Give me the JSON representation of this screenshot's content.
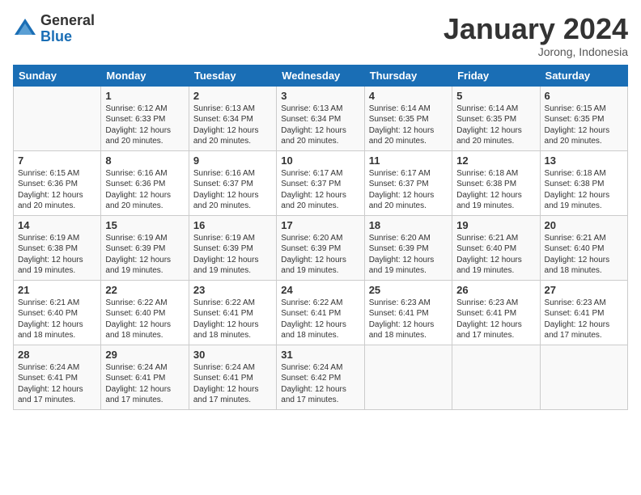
{
  "logo": {
    "general": "General",
    "blue": "Blue"
  },
  "header": {
    "month": "January 2024",
    "location": "Jorong, Indonesia"
  },
  "days_of_week": [
    "Sunday",
    "Monday",
    "Tuesday",
    "Wednesday",
    "Thursday",
    "Friday",
    "Saturday"
  ],
  "weeks": [
    [
      {
        "day": "",
        "sunrise": "",
        "sunset": "",
        "daylight": ""
      },
      {
        "day": "1",
        "sunrise": "Sunrise: 6:12 AM",
        "sunset": "Sunset: 6:33 PM",
        "daylight": "Daylight: 12 hours and 20 minutes."
      },
      {
        "day": "2",
        "sunrise": "Sunrise: 6:13 AM",
        "sunset": "Sunset: 6:34 PM",
        "daylight": "Daylight: 12 hours and 20 minutes."
      },
      {
        "day": "3",
        "sunrise": "Sunrise: 6:13 AM",
        "sunset": "Sunset: 6:34 PM",
        "daylight": "Daylight: 12 hours and 20 minutes."
      },
      {
        "day": "4",
        "sunrise": "Sunrise: 6:14 AM",
        "sunset": "Sunset: 6:35 PM",
        "daylight": "Daylight: 12 hours and 20 minutes."
      },
      {
        "day": "5",
        "sunrise": "Sunrise: 6:14 AM",
        "sunset": "Sunset: 6:35 PM",
        "daylight": "Daylight: 12 hours and 20 minutes."
      },
      {
        "day": "6",
        "sunrise": "Sunrise: 6:15 AM",
        "sunset": "Sunset: 6:35 PM",
        "daylight": "Daylight: 12 hours and 20 minutes."
      }
    ],
    [
      {
        "day": "7",
        "sunrise": "Sunrise: 6:15 AM",
        "sunset": "Sunset: 6:36 PM",
        "daylight": "Daylight: 12 hours and 20 minutes."
      },
      {
        "day": "8",
        "sunrise": "Sunrise: 6:16 AM",
        "sunset": "Sunset: 6:36 PM",
        "daylight": "Daylight: 12 hours and 20 minutes."
      },
      {
        "day": "9",
        "sunrise": "Sunrise: 6:16 AM",
        "sunset": "Sunset: 6:37 PM",
        "daylight": "Daylight: 12 hours and 20 minutes."
      },
      {
        "day": "10",
        "sunrise": "Sunrise: 6:17 AM",
        "sunset": "Sunset: 6:37 PM",
        "daylight": "Daylight: 12 hours and 20 minutes."
      },
      {
        "day": "11",
        "sunrise": "Sunrise: 6:17 AM",
        "sunset": "Sunset: 6:37 PM",
        "daylight": "Daylight: 12 hours and 20 minutes."
      },
      {
        "day": "12",
        "sunrise": "Sunrise: 6:18 AM",
        "sunset": "Sunset: 6:38 PM",
        "daylight": "Daylight: 12 hours and 19 minutes."
      },
      {
        "day": "13",
        "sunrise": "Sunrise: 6:18 AM",
        "sunset": "Sunset: 6:38 PM",
        "daylight": "Daylight: 12 hours and 19 minutes."
      }
    ],
    [
      {
        "day": "14",
        "sunrise": "Sunrise: 6:19 AM",
        "sunset": "Sunset: 6:38 PM",
        "daylight": "Daylight: 12 hours and 19 minutes."
      },
      {
        "day": "15",
        "sunrise": "Sunrise: 6:19 AM",
        "sunset": "Sunset: 6:39 PM",
        "daylight": "Daylight: 12 hours and 19 minutes."
      },
      {
        "day": "16",
        "sunrise": "Sunrise: 6:19 AM",
        "sunset": "Sunset: 6:39 PM",
        "daylight": "Daylight: 12 hours and 19 minutes."
      },
      {
        "day": "17",
        "sunrise": "Sunrise: 6:20 AM",
        "sunset": "Sunset: 6:39 PM",
        "daylight": "Daylight: 12 hours and 19 minutes."
      },
      {
        "day": "18",
        "sunrise": "Sunrise: 6:20 AM",
        "sunset": "Sunset: 6:39 PM",
        "daylight": "Daylight: 12 hours and 19 minutes."
      },
      {
        "day": "19",
        "sunrise": "Sunrise: 6:21 AM",
        "sunset": "Sunset: 6:40 PM",
        "daylight": "Daylight: 12 hours and 19 minutes."
      },
      {
        "day": "20",
        "sunrise": "Sunrise: 6:21 AM",
        "sunset": "Sunset: 6:40 PM",
        "daylight": "Daylight: 12 hours and 18 minutes."
      }
    ],
    [
      {
        "day": "21",
        "sunrise": "Sunrise: 6:21 AM",
        "sunset": "Sunset: 6:40 PM",
        "daylight": "Daylight: 12 hours and 18 minutes."
      },
      {
        "day": "22",
        "sunrise": "Sunrise: 6:22 AM",
        "sunset": "Sunset: 6:40 PM",
        "daylight": "Daylight: 12 hours and 18 minutes."
      },
      {
        "day": "23",
        "sunrise": "Sunrise: 6:22 AM",
        "sunset": "Sunset: 6:41 PM",
        "daylight": "Daylight: 12 hours and 18 minutes."
      },
      {
        "day": "24",
        "sunrise": "Sunrise: 6:22 AM",
        "sunset": "Sunset: 6:41 PM",
        "daylight": "Daylight: 12 hours and 18 minutes."
      },
      {
        "day": "25",
        "sunrise": "Sunrise: 6:23 AM",
        "sunset": "Sunset: 6:41 PM",
        "daylight": "Daylight: 12 hours and 18 minutes."
      },
      {
        "day": "26",
        "sunrise": "Sunrise: 6:23 AM",
        "sunset": "Sunset: 6:41 PM",
        "daylight": "Daylight: 12 hours and 17 minutes."
      },
      {
        "day": "27",
        "sunrise": "Sunrise: 6:23 AM",
        "sunset": "Sunset: 6:41 PM",
        "daylight": "Daylight: 12 hours and 17 minutes."
      }
    ],
    [
      {
        "day": "28",
        "sunrise": "Sunrise: 6:24 AM",
        "sunset": "Sunset: 6:41 PM",
        "daylight": "Daylight: 12 hours and 17 minutes."
      },
      {
        "day": "29",
        "sunrise": "Sunrise: 6:24 AM",
        "sunset": "Sunset: 6:41 PM",
        "daylight": "Daylight: 12 hours and 17 minutes."
      },
      {
        "day": "30",
        "sunrise": "Sunrise: 6:24 AM",
        "sunset": "Sunset: 6:41 PM",
        "daylight": "Daylight: 12 hours and 17 minutes."
      },
      {
        "day": "31",
        "sunrise": "Sunrise: 6:24 AM",
        "sunset": "Sunset: 6:42 PM",
        "daylight": "Daylight: 12 hours and 17 minutes."
      },
      {
        "day": "",
        "sunrise": "",
        "sunset": "",
        "daylight": ""
      },
      {
        "day": "",
        "sunrise": "",
        "sunset": "",
        "daylight": ""
      },
      {
        "day": "",
        "sunrise": "",
        "sunset": "",
        "daylight": ""
      }
    ]
  ]
}
